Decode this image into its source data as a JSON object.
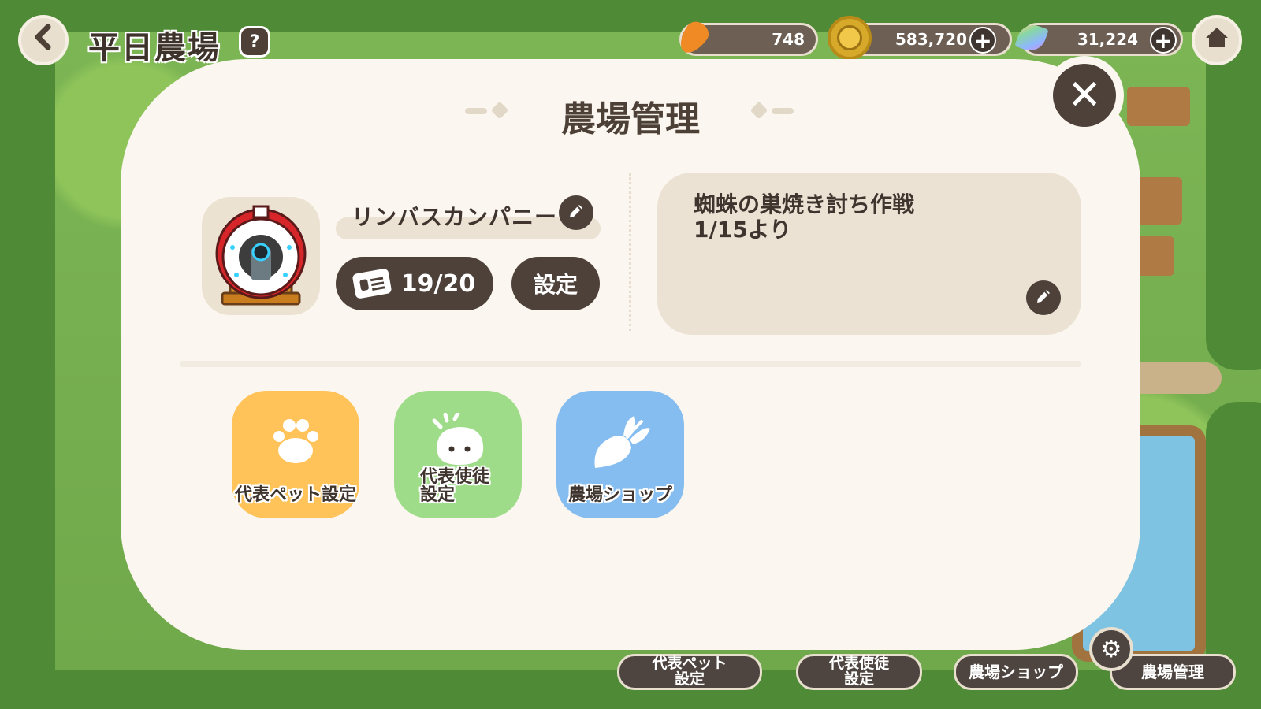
{
  "hud": {
    "farm_title": "平日農場",
    "help_icon_glyph": "?",
    "back_icon_glyph": "‹",
    "resources": {
      "carrot": "748",
      "coin": "583,720",
      "gem": "31,224"
    },
    "plus_glyph": "+"
  },
  "modal": {
    "title": "農場管理",
    "close_glyph": "✕",
    "farm_name": "リンバスカンパニー",
    "visitors": "19/20",
    "settings_label": "設定",
    "notice": "蜘蛛の巣焼き討ち作戦\n1/15より",
    "menu": [
      {
        "label": "代表ペット設定",
        "color": "#ffc35a"
      },
      {
        "label": "代表使徒\n設定",
        "color": "#9fdc8a"
      },
      {
        "label": "農場ショップ",
        "color": "#85bdf0"
      }
    ]
  },
  "bottom_bar": {
    "pet": "代表ペット\n設定",
    "student": "代表使徒\n設定",
    "shop": "農場ショップ",
    "manage": "農場管理",
    "gear_glyph": "⚙"
  },
  "icons": {
    "back": "chevron-left-icon",
    "help": "help-book-icon",
    "home": "home-icon",
    "carrot": "carrot-icon",
    "coin": "coin-icon",
    "gem": "gem-icon",
    "edit": "pencil-icon",
    "ticket": "ticket-icon",
    "paw": "paw-icon",
    "blob": "blob-icon",
    "radish": "radish-icon",
    "gear": "gear-icon"
  },
  "colors": {
    "modal_bg": "#fbf6ef",
    "dark_button": "#4d413a",
    "pet_tile": "#ffc35a",
    "student_tile": "#9fdc8a",
    "shop_tile": "#85bdf0"
  }
}
